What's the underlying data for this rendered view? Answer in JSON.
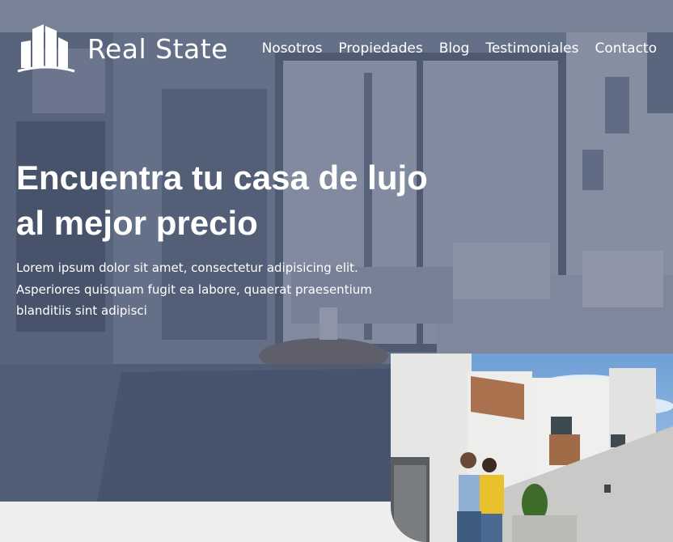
{
  "brand": {
    "name": "Real State",
    "logo_icon": "buildings-icon"
  },
  "nav": {
    "items": [
      {
        "label": "Nosotros"
      },
      {
        "label": "Propiedades"
      },
      {
        "label": "Blog"
      },
      {
        "label": "Testimoniales"
      },
      {
        "label": "Contacto"
      }
    ]
  },
  "hero": {
    "title": "Encuentra tu casa de lujo al mejor precio",
    "text": "Lorem ipsum dolor sit amet, consectetur adipisicing elit. Asperiores quisquam fugit ea labore, quaerat praesentium blanditiis sint adipisci",
    "overlay_color": "#465270"
  }
}
